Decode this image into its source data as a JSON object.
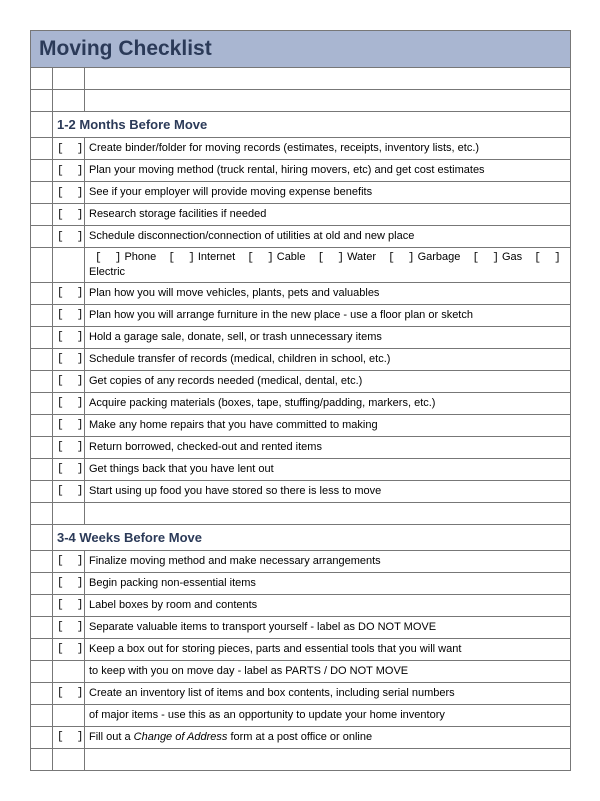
{
  "title": "Moving Checklist",
  "sections": [
    {
      "heading": "1-2 Months Before Move",
      "rows": [
        {
          "text": "Create binder/folder for moving records (estimates, receipts, inventory lists, etc.)"
        },
        {
          "text": "Plan your moving method (truck rental, hiring movers, etc) and get cost estimates"
        },
        {
          "text": "See if your employer will provide moving expense benefits"
        },
        {
          "text": "Research storage facilities if needed"
        },
        {
          "text": "Schedule disconnection/connection of utilities at old and new place"
        },
        {
          "type": "subchecks",
          "items": [
            "Phone",
            "Internet",
            "Cable",
            "Water",
            "Garbage",
            "Gas",
            "Electric"
          ]
        },
        {
          "text": "Plan how you will move vehicles, plants, pets and valuables"
        },
        {
          "text": "Plan how you will arrange furniture in the new place - use a floor plan or sketch"
        },
        {
          "text": "Hold a garage sale, donate, sell, or trash unnecessary items"
        },
        {
          "text": "Schedule transfer of records (medical, children in school, etc.)"
        },
        {
          "text": "Get copies of any records needed (medical, dental, etc.)"
        },
        {
          "text": "Acquire packing materials (boxes, tape, stuffing/padding, markers, etc.)"
        },
        {
          "text": "Make any home repairs that you have committed to making"
        },
        {
          "text": "Return borrowed, checked-out and rented items"
        },
        {
          "text": "Get things back that you have lent out"
        },
        {
          "text": "Start using up food you have stored so there is less to move"
        }
      ]
    },
    {
      "heading": "3-4 Weeks Before Move",
      "rows": [
        {
          "text": "Finalize moving method and make necessary arrangements"
        },
        {
          "text": "Begin packing non-essential items"
        },
        {
          "text": "Label boxes by room and contents"
        },
        {
          "text": "Separate valuable items to transport yourself - label as DO NOT MOVE"
        },
        {
          "type": "multi",
          "lines": [
            "Keep a box out for storing pieces, parts and essential tools that you will want",
            "to keep with you on move day - label as PARTS / DO NOT MOVE"
          ]
        },
        {
          "type": "multi",
          "lines": [
            "Create an inventory list of items and box contents, including serial numbers",
            "of major items - use this as an opportunity to update your home inventory"
          ]
        },
        {
          "type": "richtext",
          "parts": [
            {
              "t": "Fill out a "
            },
            {
              "t": "Change of Address",
              "italic": true
            },
            {
              "t": " form at a post office or online"
            }
          ]
        }
      ]
    }
  ]
}
